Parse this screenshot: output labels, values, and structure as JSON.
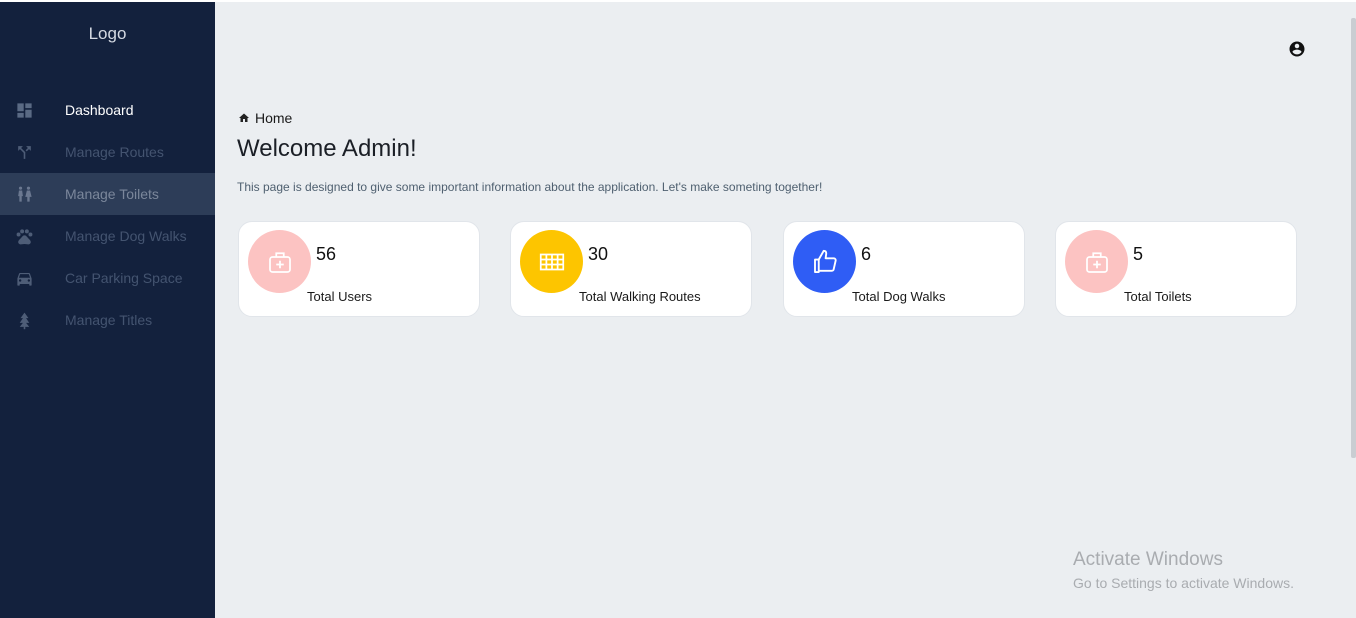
{
  "sidebar": {
    "logo": "Logo",
    "items": [
      {
        "label": "Dashboard",
        "icon": "dashboard-icon"
      },
      {
        "label": "Manage Routes",
        "icon": "routes-icon"
      },
      {
        "label": "Manage Toilets",
        "icon": "toilet-icon"
      },
      {
        "label": "Manage Dog Walks",
        "icon": "paw-icon"
      },
      {
        "label": "Car Parking Space",
        "icon": "car-icon"
      },
      {
        "label": "Manage Titles",
        "icon": "tree-icon"
      }
    ]
  },
  "header": {
    "user_icon": "account-circle-icon"
  },
  "breadcrumb": {
    "label": "Home",
    "icon": "home-icon"
  },
  "page": {
    "title": "Welcome Admin!",
    "description": "This page is designed to give some important information about the application. Let's make someting together!"
  },
  "cards": [
    {
      "value": "56",
      "label": "Total Users",
      "icon": "medical-kit-icon",
      "color": "#fcc3c2"
    },
    {
      "value": "30",
      "label": "Total Walking Routes",
      "icon": "grid-table-icon",
      "color": "#fdc500"
    },
    {
      "value": "6",
      "label": "Total Dog Walks",
      "icon": "thumbs-up-icon",
      "color": "#2f5df5"
    },
    {
      "value": "5",
      "label": "Total Toilets",
      "icon": "medical-kit-icon",
      "color": "#fcc3c2"
    }
  ],
  "watermark": {
    "title": "Activate Windows",
    "subtitle": "Go to Settings to activate Windows."
  },
  "colors": {
    "sidebar_bg": "#13213d",
    "main_bg": "#ebeef1",
    "active_item_bg": "#2d3d58"
  }
}
